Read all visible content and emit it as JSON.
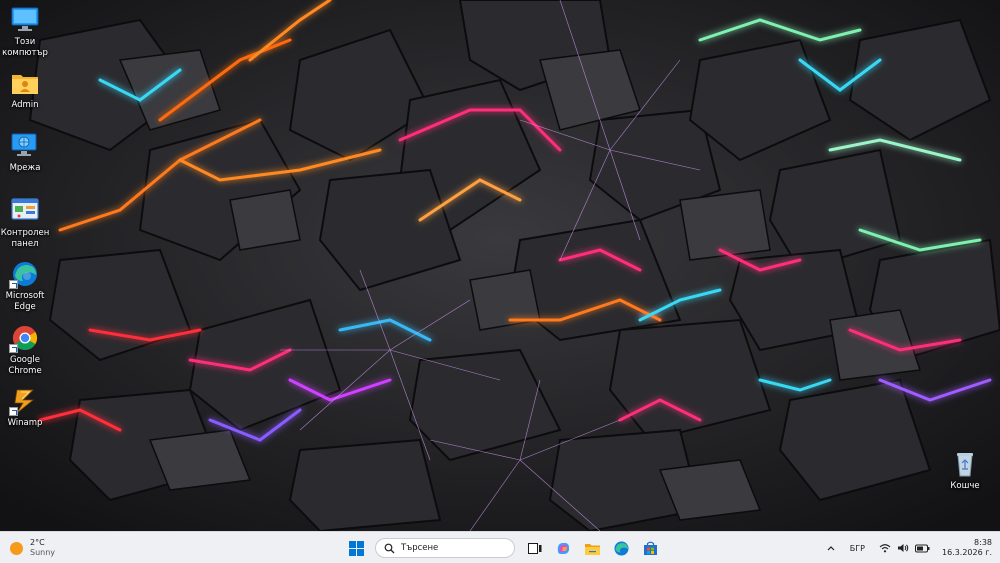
{
  "desktop": {
    "icons": [
      {
        "label": "Този компютър",
        "icon": "monitor-icon"
      },
      {
        "label": "Admin",
        "icon": "user-folder-icon"
      },
      {
        "label": "Мрежа",
        "icon": "network-icon"
      },
      {
        "label": "Контролен панел",
        "icon": "control-panel-icon"
      },
      {
        "label": "Microsoft Edge",
        "icon": "edge-icon"
      },
      {
        "label": "Google Chrome",
        "icon": "chrome-icon"
      },
      {
        "label": "Winamp",
        "icon": "winamp-icon"
      },
      {
        "label": "Кошче",
        "icon": "recycle-bin-icon"
      }
    ]
  },
  "taskbar": {
    "weather": {
      "temp": "2°C",
      "condition": "Sunny",
      "icon": "sun-icon"
    },
    "search": {
      "placeholder": "Търсене"
    },
    "apps": [
      "windows-start-icon",
      "task-view-icon",
      "copilot-icon",
      "file-explorer-icon",
      "edge-icon",
      "store-icon"
    ],
    "tray": {
      "language": "БГР",
      "time": "8:38",
      "date": "16.3.2026 г."
    }
  },
  "colors": {
    "taskbar_bg": "#eef0f4",
    "accent_blue": "#0078d4",
    "wallpaper_base": "#151517",
    "neon_orange": "#ff7a1a",
    "neon_pink": "#ff2d7a",
    "neon_cyan": "#38d9f5",
    "neon_green": "#7ff0b0",
    "neon_purple": "#a05cff"
  }
}
